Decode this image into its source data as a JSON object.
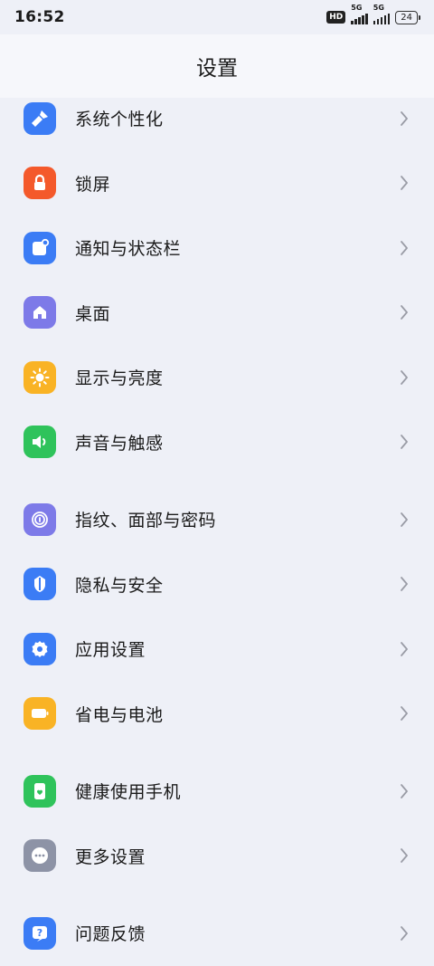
{
  "status": {
    "time": "16:52",
    "hd": "HD",
    "network1": "5G",
    "network2": "5G",
    "battery": "24"
  },
  "header": {
    "title": "设置"
  },
  "colors": {
    "blue": "#3b7cf5",
    "orange": "#f4592b",
    "purple": "#7d7ae8",
    "yellow": "#f9b325",
    "green": "#2fc35b",
    "gray": "#8d93a6"
  },
  "groups": [
    {
      "items": [
        {
          "label": "系统个性化",
          "icon": "brush-icon"
        },
        {
          "label": "锁屏",
          "icon": "lock-icon"
        },
        {
          "label": "通知与状态栏",
          "icon": "notification-icon"
        },
        {
          "label": "桌面",
          "icon": "home-icon"
        },
        {
          "label": "显示与亮度",
          "icon": "sun-icon"
        },
        {
          "label": "声音与触感",
          "icon": "speaker-icon"
        }
      ]
    },
    {
      "items": [
        {
          "label": "指纹、面部与密码",
          "icon": "fingerprint-icon"
        },
        {
          "label": "隐私与安全",
          "icon": "shield-icon"
        },
        {
          "label": "应用设置",
          "icon": "gear-icon"
        },
        {
          "label": "省电与电池",
          "icon": "battery-icon"
        }
      ]
    },
    {
      "items": [
        {
          "label": "健康使用手机",
          "icon": "health-phone-icon"
        },
        {
          "label": "更多设置",
          "icon": "more-icon"
        }
      ]
    },
    {
      "items": [
        {
          "label": "问题反馈",
          "icon": "help-icon"
        }
      ]
    }
  ]
}
